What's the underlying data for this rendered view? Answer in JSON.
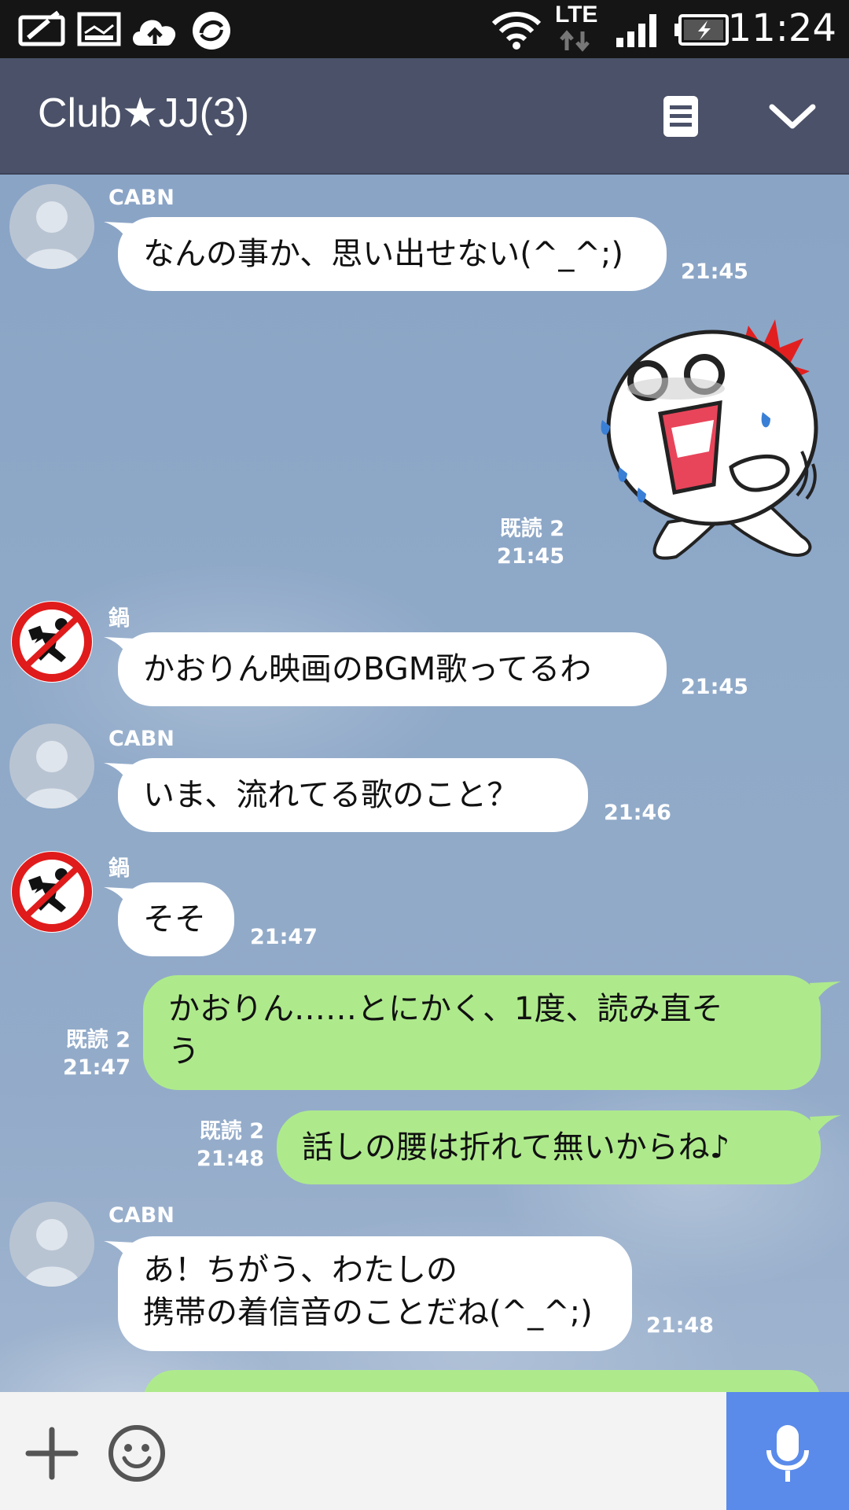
{
  "status_bar": {
    "time": "11:24",
    "network": "LTE",
    "icons": [
      "message-icon",
      "image-icon",
      "cloud-upload-icon",
      "sync-icon",
      "wifi-icon",
      "lte-icon",
      "signal-icon",
      "battery-charging-icon"
    ]
  },
  "header": {
    "title": "Club★JJ(3)",
    "icons": [
      "note-icon",
      "chevron-down-icon"
    ]
  },
  "messages": [
    {
      "sender": "CABN",
      "text": "なんの事か、思い出せない(^_^;)",
      "time": "21:45",
      "direction": "incoming"
    },
    {
      "type": "sticker",
      "read": "既読 2",
      "time": "21:45",
      "direction": "outgoing"
    },
    {
      "sender": "鍋",
      "text": "かおりん映画のBGM歌ってるわ",
      "time": "21:45",
      "direction": "incoming"
    },
    {
      "sender": "CABN",
      "text": "いま、流れてる歌のこと？",
      "time": "21:46",
      "direction": "incoming"
    },
    {
      "sender": "鍋",
      "text": "そそ",
      "time": "21:47",
      "direction": "incoming"
    },
    {
      "read": "既読 2",
      "time": "21:47",
      "direction": "outgoing",
      "line1": "かおりん……とにかく、1度、読み直そ",
      "line2": "う"
    },
    {
      "read": "既読 2",
      "time": "21:48",
      "direction": "outgoing",
      "text": "話しの腰は折れて無いからね♪"
    },
    {
      "sender": "CABN",
      "line1": "あ！ちがう、わたしの",
      "line2": "携帯の着信音のことだね(^_^;)",
      "time": "21:48",
      "direction": "incoming"
    }
  ],
  "input_bar": {
    "icons": [
      "plus-icon",
      "emoji-icon",
      "microphone-icon"
    ]
  },
  "colors": {
    "header": "#4a5168",
    "outgoing_bubble": "#aeea8c",
    "incoming_bubble": "#ffffff",
    "mic_button": "#5a8bea"
  }
}
